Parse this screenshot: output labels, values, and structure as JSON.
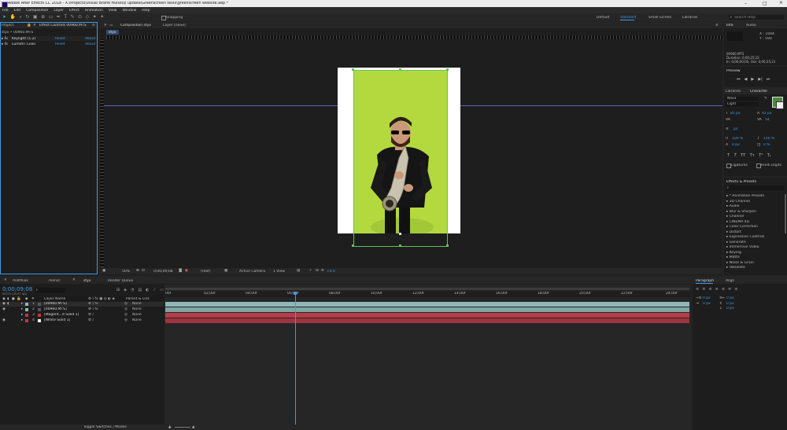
{
  "window": {
    "title": "Adobe After Effects CC 2018 - X:\\Projects\\Visual Brand Huisstijl update\\Greenscreen tests\\greenscreen website.aep *",
    "minimize": "–",
    "maximize": "□",
    "close": "✕"
  },
  "menu": [
    "File",
    "Edit",
    "Composition",
    "Layer",
    "Effect",
    "Animation",
    "View",
    "Window",
    "Help"
  ],
  "toolbar": {
    "snapping": "Snapping",
    "workspaces": [
      "Default",
      "Standard",
      "Small Screen",
      "Libraries"
    ],
    "search_placeholder": "Search Help"
  },
  "project": {
    "tab": "Project",
    "file": "styx • 00960.MTS"
  },
  "effect_controls": {
    "tab": "Effect Controls 00960.MTS",
    "effects": [
      {
        "name": "Keylight (1.2)",
        "reset": "Reset",
        "about": "About"
      },
      {
        "name": "Lumetri Color",
        "reset": "Reset",
        "about": "About"
      }
    ]
  },
  "composition": {
    "tab": "Composition styx",
    "layer_tab": "Layer (none)",
    "comp_label": "styx"
  },
  "viewer": {
    "zoom": "50%",
    "timecode": "0;00;09;08",
    "resolution": "(Half)",
    "camera": "Active Camera",
    "views": "1 View",
    "exposure": "+0.0"
  },
  "info": {
    "tabs": [
      "Info",
      "Audio"
    ],
    "x": "X : 1044",
    "y": "Y : 590",
    "file": "00960.MTS",
    "duration": "Duration: 0;00;25;22",
    "inout": "In: 0;00;00;00, Out: 0;00;25;21"
  },
  "preview": {
    "title": "Preview"
  },
  "character": {
    "tabs": [
      "Libraries",
      "Character"
    ],
    "font": "Nexa",
    "style": "Light",
    "size": "85 px",
    "leading": "42 px",
    "kerning": "",
    "tracking": "54",
    "vscale": "100 %",
    "hscale": "100 %",
    "baseline": "0 px",
    "tsume": "0 %",
    "stroke": "px",
    "ligatures": "Ligatures",
    "hindi": "Hindi Digits"
  },
  "effects_presets": {
    "title": "Effects & Presets",
    "search_placeholder": "",
    "items": [
      "* Animation Presets",
      "3D Channel",
      "Audio",
      "Blur & Sharpen",
      "Channel",
      "CINEMA 4D",
      "Color Correction",
      "Distort",
      "Expression Controls",
      "Generate",
      "Immersive Video",
      "Keying",
      "Matte",
      "Noise & Grain",
      "Obsolete"
    ]
  },
  "timeline": {
    "tabs": [
      "matthias",
      "mensc",
      "styx",
      "Render Queue"
    ],
    "timecode": "0;00;09;08",
    "fps": "00275 (29.97 fps)",
    "headers": {
      "num": "#",
      "name": "Layer Name",
      "parent": "Parent & Link"
    },
    "layers": [
      {
        "num": "1",
        "name": "[00960.MTS]",
        "parent": "None",
        "color": "#8fb7b7"
      },
      {
        "num": "2",
        "name": "[00960.MTS]",
        "parent": "None",
        "color": "#8fb7b7"
      },
      {
        "num": "3",
        "name": "[Magent...d Solid 1]",
        "parent": "None",
        "color": "#b63c46"
      },
      {
        "num": "4",
        "name": "[White Solid 1]",
        "parent": "None",
        "color": "#b63c46"
      }
    ],
    "ruler": [
      "00f",
      "02;00f",
      "04;00f",
      "06;00f",
      "08;00f",
      "10;00f",
      "12;00f",
      "14;00f",
      "16;00f",
      "18;00f",
      "20;00f",
      "22;00f",
      "24;00f"
    ],
    "footer": "Toggle Switches / Modes"
  },
  "paragraph": {
    "tabs": [
      "Paragraph",
      "Align"
    ],
    "indent_left": "0 px",
    "indent_right": "0 px",
    "indent_first": "0 px",
    "space_before": "0 px",
    "space_after": "0 px"
  },
  "colors": {
    "accent": "#3d9ae8",
    "green": "#b4d93e",
    "layer_teal": "#8fb7b7",
    "layer_red": "#b63c46"
  }
}
